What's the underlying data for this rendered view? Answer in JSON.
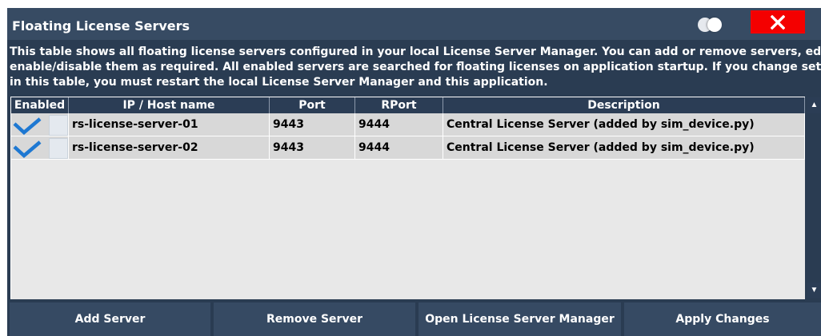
{
  "dialog": {
    "title": "Floating License Servers",
    "close_icon": "close-icon",
    "description": [
      "This table shows all floating license servers configured in your local License Server Manager. You can add or remove servers, edit or",
      "enable/disable them as required. All enabled servers are searched for floating licenses on application startup. If you change settings",
      "in this table, you must restart the local License Server Manager and this application."
    ]
  },
  "table": {
    "columns": [
      "Enabled",
      "IP / Host name",
      "Port",
      "RPort",
      "Description"
    ],
    "rows": [
      {
        "enabled": true,
        "host": "rs-license-server-01",
        "port": "9443",
        "rport": "9444",
        "description": "Central License Server (added by sim_device.py)"
      },
      {
        "enabled": true,
        "host": "rs-license-server-02",
        "port": "9443",
        "rport": "9444",
        "description": "Central License Server (added by sim_device.py)"
      }
    ]
  },
  "buttons": {
    "add": "Add Server",
    "remove": "Remove Server",
    "open_manager": "Open License Server Manager",
    "apply": "Apply Changes"
  },
  "colors": {
    "dialog_bg": "#2a3c52",
    "title_bar": "#374b63",
    "close_red": "#f40000",
    "checkmark_blue": "#1e78d2",
    "row_bg": "#d8d8d8"
  }
}
